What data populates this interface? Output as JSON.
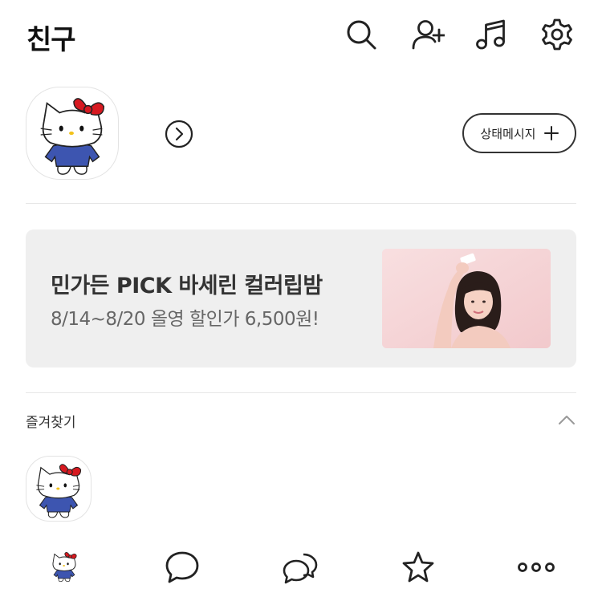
{
  "header": {
    "title": "친구",
    "icons": [
      "search-icon",
      "add-friend-icon",
      "music-icon",
      "settings-icon"
    ]
  },
  "profile": {
    "status_message_button": "상태메시지",
    "icons": [
      "chevron-right-circle-icon",
      "plus-icon"
    ]
  },
  "banner": {
    "title": "민가든 PICK 바세린 컬러립밤",
    "subtitle": "8/14~8/20 올영 할인가 6,500원!",
    "background_color": "#efefef"
  },
  "favorites": {
    "label": "즐겨찾기",
    "collapse_icon": "chevron-up-icon"
  },
  "tabbar": {
    "items": [
      "friends-tab",
      "chats-tab",
      "open-chat-tab",
      "shopping-tab",
      "more-tab"
    ],
    "icons": [
      "profile-avatar",
      "speech-bubble-icon",
      "double-bubble-icon",
      "star-icon",
      "more-dots-icon"
    ]
  },
  "colors": {
    "text_primary": "#111111",
    "divider": "#e6e6e6",
    "banner_bg": "#efefef",
    "kitty_bow": "#d71920",
    "kitty_shirt": "#3d55b0"
  }
}
